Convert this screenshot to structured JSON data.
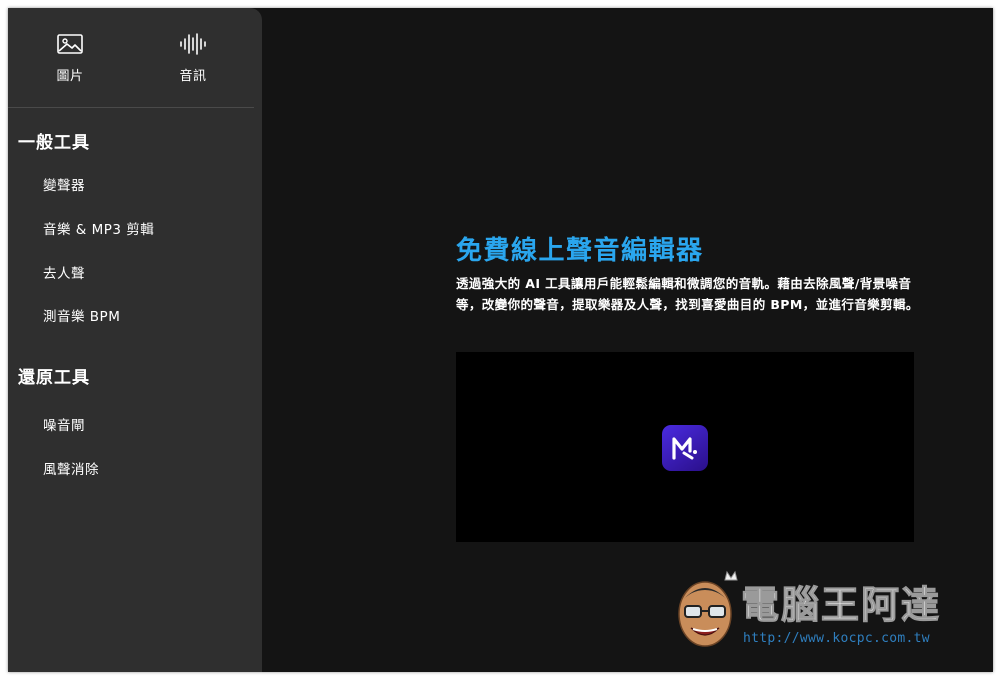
{
  "sidebar": {
    "modes": [
      {
        "label": "圖片",
        "icon": "image-icon"
      },
      {
        "label": "音訊",
        "icon": "audio-waveform-icon"
      }
    ],
    "sections": [
      {
        "heading": "一般工具",
        "items": [
          "變聲器",
          "音樂 & MP3 剪輯",
          "去人聲",
          "測音樂 BPM"
        ]
      },
      {
        "heading": "還原工具",
        "items": [
          "噪音閘",
          "風聲消除"
        ]
      }
    ]
  },
  "main": {
    "title": "免費線上聲音編輯器",
    "description": "透過強大的 AI 工具讓用戶能輕鬆編輯和微調您的音軌。藉由去除風聲/背景噪音等，改變你的聲音，提取樂器及人聲，找到喜愛曲目的 BPM，並進行音樂剪輯。",
    "video_logo_icon": "media-io-logo-icon"
  },
  "watermark": {
    "title": "電腦王阿達",
    "url": "http://www.kocpc.com.tw"
  },
  "colors": {
    "background": "#141414",
    "sidebar": "#2f2f2f",
    "accent": "#2aa6ee",
    "logo": "#3a1fc0"
  }
}
